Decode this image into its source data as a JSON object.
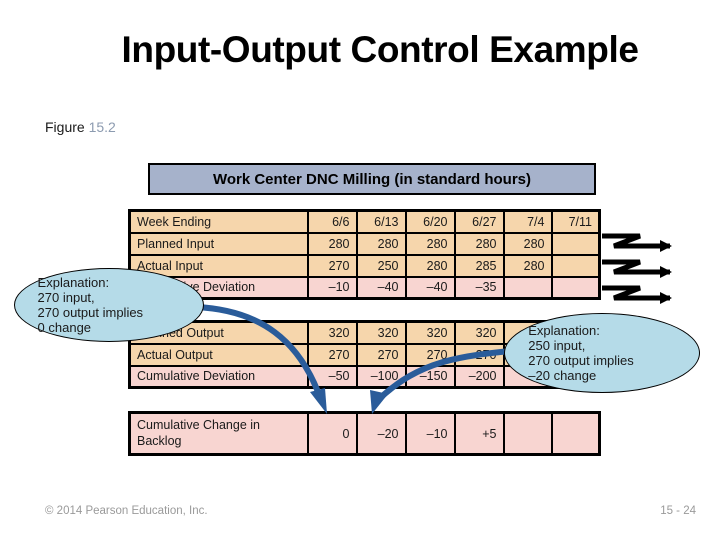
{
  "slide": {
    "title": "Input-Output Control\nExample",
    "figure_label": "Figure",
    "figure_number": "15.2"
  },
  "banner": {
    "text": "Work Center DNC Milling (in standard hours)"
  },
  "colors": {
    "banner_fill": "#a6b2cb",
    "tan_cell": "#f6d6ac",
    "pink_cell": "#f8d5d1",
    "balloon_fill": "#b5dbe8",
    "arrow_blue": "#2a5c9a",
    "figure_number": "#8c9bb0",
    "footer_gray": "#9a9a9a"
  },
  "table_top": {
    "rows": [
      {
        "label": "Week Ending",
        "tone": "tan",
        "values": [
          "6/6",
          "6/13",
          "6/20",
          "6/27",
          "7/4",
          "7/11"
        ]
      },
      {
        "label": "Planned Input",
        "tone": "tan",
        "values": [
          "280",
          "280",
          "280",
          "280",
          "280",
          ""
        ]
      },
      {
        "label": "Actual Input",
        "tone": "tan",
        "values": [
          "270",
          "250",
          "280",
          "285",
          "280",
          ""
        ]
      },
      {
        "label": "Cumulative Deviation",
        "tone": "pink",
        "values": [
          "–10",
          "–40",
          "–40",
          "–35",
          "",
          ""
        ]
      }
    ]
  },
  "table_mid": {
    "rows": [
      {
        "label": "Planned Output",
        "tone": "tan",
        "values": [
          "320",
          "320",
          "320",
          "320",
          "",
          ""
        ]
      },
      {
        "label": "Actual Output",
        "tone": "tan",
        "values": [
          "270",
          "270",
          "270",
          "270",
          "",
          ""
        ]
      },
      {
        "label": "Cumulative Deviation",
        "tone": "pink",
        "values": [
          "–50",
          "–100",
          "–150",
          "–200",
          "",
          ""
        ]
      }
    ]
  },
  "table_bottom": {
    "rows": [
      {
        "label": "Cumulative Change in Backlog",
        "tone": "pink",
        "values": [
          "0",
          "–20",
          "–10",
          "+5",
          "",
          ""
        ]
      }
    ]
  },
  "balloons": {
    "left": {
      "text": "Explanation:\n270 input,\n270 output implies\n0 change"
    },
    "right": {
      "text": "Explanation:\n250 input,\n270 output implies\n–20 change"
    }
  },
  "arrows": {
    "zigzag_count": 3,
    "zigzag_name": "zigzag-right-arrow"
  },
  "footer": {
    "copyright": "© 2014 Pearson Education, Inc.",
    "page_number": "15 - 24"
  }
}
